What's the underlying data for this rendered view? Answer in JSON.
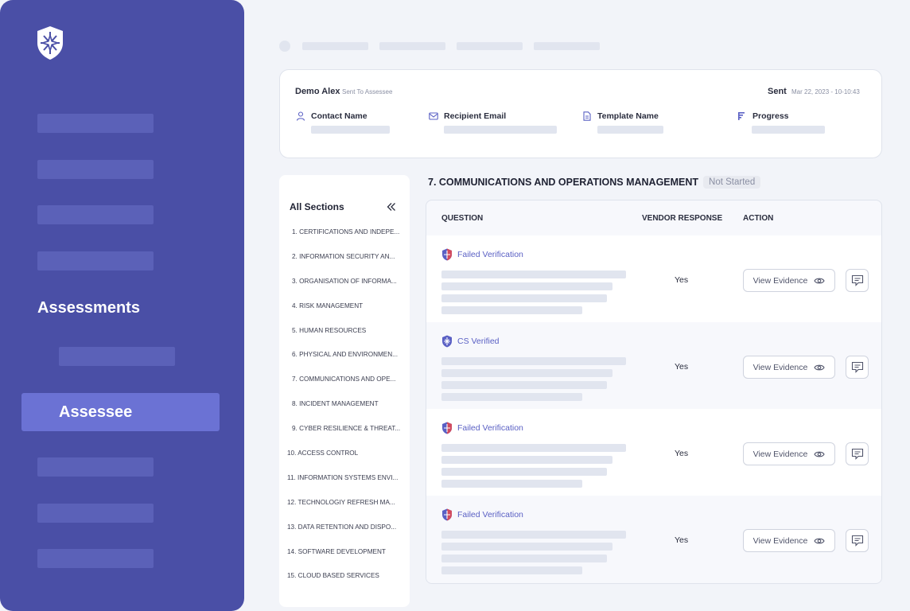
{
  "sidebar": {
    "logo_icon": "shield-star-icon",
    "assessments_label": "Assessments",
    "active_item_label": "Assessee",
    "colors": {
      "background": "#4a4fa6",
      "active": "#6b72d4",
      "placeholder": "#5b61b8"
    }
  },
  "info": {
    "assessor_name": "Demo Alex",
    "assessor_status": "Sent To Assessee",
    "sent_label": "Sent",
    "sent_date": "Mar 22, 2023 - 10-10:43",
    "fields": [
      {
        "label": "Contact Name",
        "icon": "user-icon"
      },
      {
        "label": "Recipient Email",
        "icon": "mail-icon"
      },
      {
        "label": "Template Name",
        "icon": "document-icon"
      },
      {
        "label": "Progress",
        "icon": "progress-icon"
      }
    ]
  },
  "sections_panel": {
    "title": "All Sections",
    "items": [
      "1. CERTIFICATIONS AND INDEPE...",
      "2. INFORMATION SECURITY AN...",
      "3. ORGANISATION OF INFORMA...",
      "4. RISK MANAGEMENT",
      "5. HUMAN RESOURCES",
      "6. PHYSICAL AND ENVIRONMEN...",
      "7. COMMUNICATIONS AND OPE...",
      "8. INCIDENT MANAGEMENT",
      "9. CYBER RESILIENCE & THREAT...",
      "10. ACCESS CONTROL",
      "11. INFORMATION SYSTEMS ENVI...",
      "12. TECHNOLOGIY REFRESH MA...",
      "13. DATA RETENTION AND DISPO...",
      "14. SOFTWARE DEVELOPMENT",
      "15. CLOUD BASED SERVICES"
    ]
  },
  "main": {
    "section_title": "7. COMMUNICATIONS AND OPERATIONS MANAGEMENT",
    "section_status": "Not Started",
    "columns": {
      "question": "QUESTION",
      "response": "VENDOR RESPONSE",
      "action": "ACTION"
    },
    "rows": [
      {
        "verification": "Failed Verification",
        "verification_type": "failed",
        "response": "Yes",
        "action_label": "View Evidence"
      },
      {
        "verification": "CS Verified",
        "verification_type": "verified",
        "response": "Yes",
        "action_label": "View Evidence"
      },
      {
        "verification": "Failed Verification",
        "verification_type": "failed",
        "response": "Yes",
        "action_label": "View Evidence"
      },
      {
        "verification": "Failed Verification",
        "verification_type": "failed",
        "response": "Yes",
        "action_label": "View Evidence"
      }
    ],
    "colors": {
      "verification_text": "#5a60c4",
      "failed_accent": "#e5484d"
    }
  }
}
